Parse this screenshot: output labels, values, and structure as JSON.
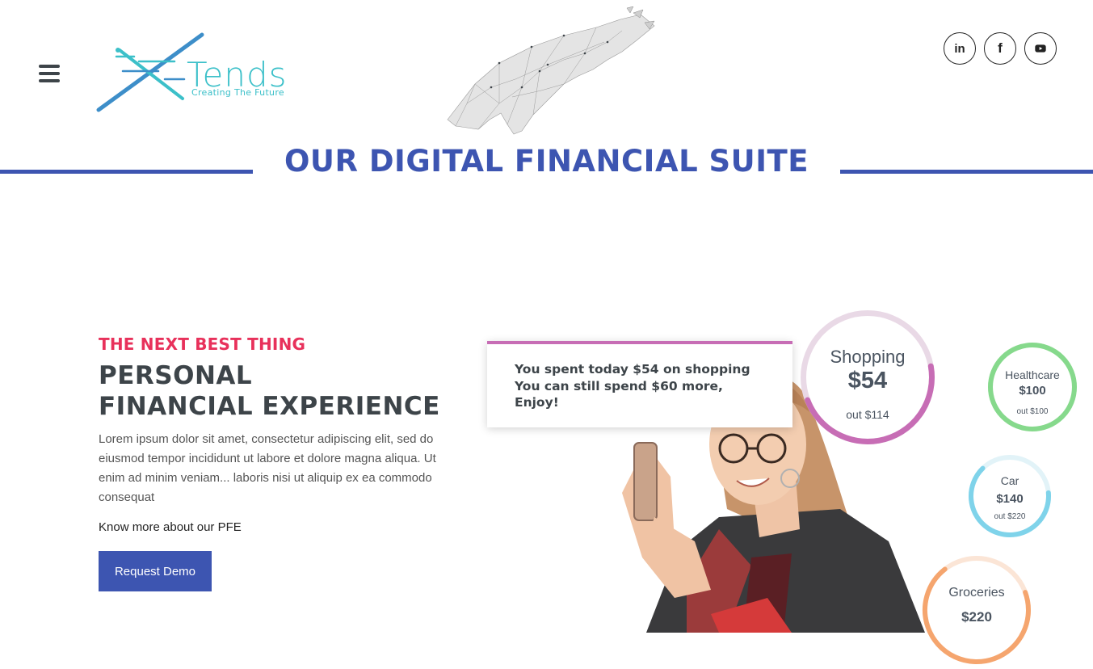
{
  "header": {
    "logo_text": "Tends",
    "logo_tagline": "Creating The Future",
    "social": [
      {
        "name": "linkedin",
        "label": "in"
      },
      {
        "name": "facebook",
        "label": "f"
      },
      {
        "name": "youtube",
        "label": "youtube"
      }
    ]
  },
  "section": {
    "title": "OUR DIGITAL FINANCIAL SUITE"
  },
  "hero": {
    "eyebrow": "THE NEXT BEST THING",
    "headline_line1": "PERSONAL",
    "headline_line2": "FINANCIAL EXPERIENCE",
    "body": "Lorem ipsum dolor sit amet, consectetur adipiscing elit, sed do eiusmod tempor incididunt ut labore et dolore magna aliqua. Ut enim ad minim veniam... laboris nisi ut aliquip ex ea commodo consequat",
    "know_more": "Know more about our PFE",
    "cta_label": "Request Demo"
  },
  "notification": {
    "line1": "You spent today $54 on shopping",
    "line2": "You can still spend $60 more,",
    "line3": "Enjoy!"
  },
  "budgets": {
    "shopping": {
      "category": "Shopping",
      "amount": "$54",
      "limit": "out $114",
      "fraction": 0.47,
      "color": "#c76db5",
      "track": "#e9d9e6"
    },
    "healthcare": {
      "category": "Healthcare",
      "amount": "$100",
      "limit": "out $100",
      "fraction": 1.0,
      "color": "#86d98c",
      "track": "#dff3e0"
    },
    "car": {
      "category": "Car",
      "amount": "$140",
      "limit": "out $220",
      "fraction": 0.64,
      "color": "#7fd3ea",
      "track": "#e2f3f8"
    },
    "groceries": {
      "category": "Groceries",
      "amount": "$220",
      "limit": "",
      "fraction": 0.7,
      "color": "#f5a56e",
      "track": "#fbe5d6"
    }
  },
  "colors": {
    "brand_blue": "#3d55b1",
    "accent_red": "#e8315b",
    "logo_teal": "#3cc0c9",
    "dark_text": "#3d4449"
  }
}
